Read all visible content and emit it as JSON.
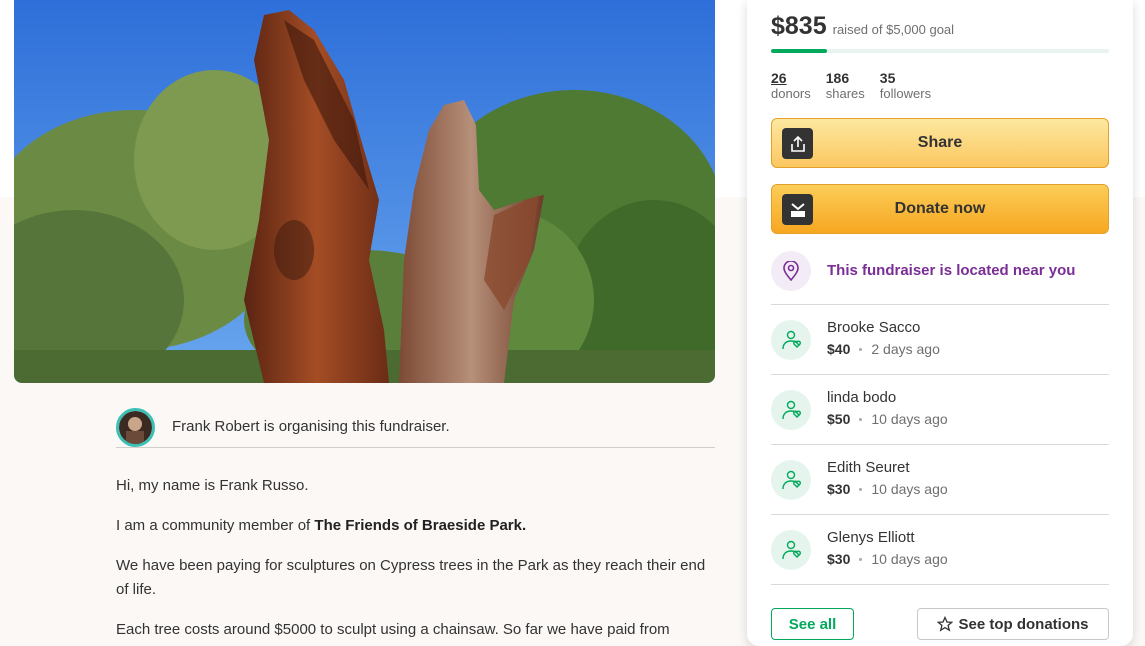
{
  "fundraiser": {
    "organiser_text": "Frank Robert is organising this fundraiser.",
    "story": {
      "p1": "Hi, my name is Frank Russo.",
      "p2_prefix": "I am a community member of ",
      "p2_bold": "The Friends of Braeside Park.",
      "p3": "We have been paying for sculptures on Cypress trees in the Park as they reach their end of life.",
      "p4": "Each tree costs around $5000 to sculpt using a chainsaw. So far we have paid from"
    }
  },
  "sidebar": {
    "raised_amount": "$835",
    "raised_goal": "raised of $5,000 goal",
    "progress_fraction": 0.167,
    "stats": {
      "donors_num": "26",
      "donors_label": "donors",
      "shares_num": "186",
      "shares_label": "shares",
      "followers_num": "35",
      "followers_label": "followers"
    },
    "share_label": "Share",
    "donate_label": "Donate now",
    "location_text": "This fundraiser is located near you",
    "donations": [
      {
        "name": "Brooke Sacco",
        "amount": "$40",
        "time": "2 days ago"
      },
      {
        "name": "linda bodo",
        "amount": "$50",
        "time": "10 days ago"
      },
      {
        "name": "Edith Seuret",
        "amount": "$30",
        "time": "10 days ago"
      },
      {
        "name": "Glenys Elliott",
        "amount": "$30",
        "time": "10 days ago"
      }
    ],
    "see_all_label": "See all",
    "see_top_label": "See top donations"
  },
  "colors": {
    "accent_green": "#02a95c",
    "donate_orange": "#f7a721",
    "location_purple": "#7a2e96"
  },
  "icons": {
    "share": "share-upload-icon",
    "donate": "gofundme-logo-icon",
    "location": "location-pin-icon",
    "donor": "donor-heart-hand-icon",
    "top": "star-icon"
  }
}
